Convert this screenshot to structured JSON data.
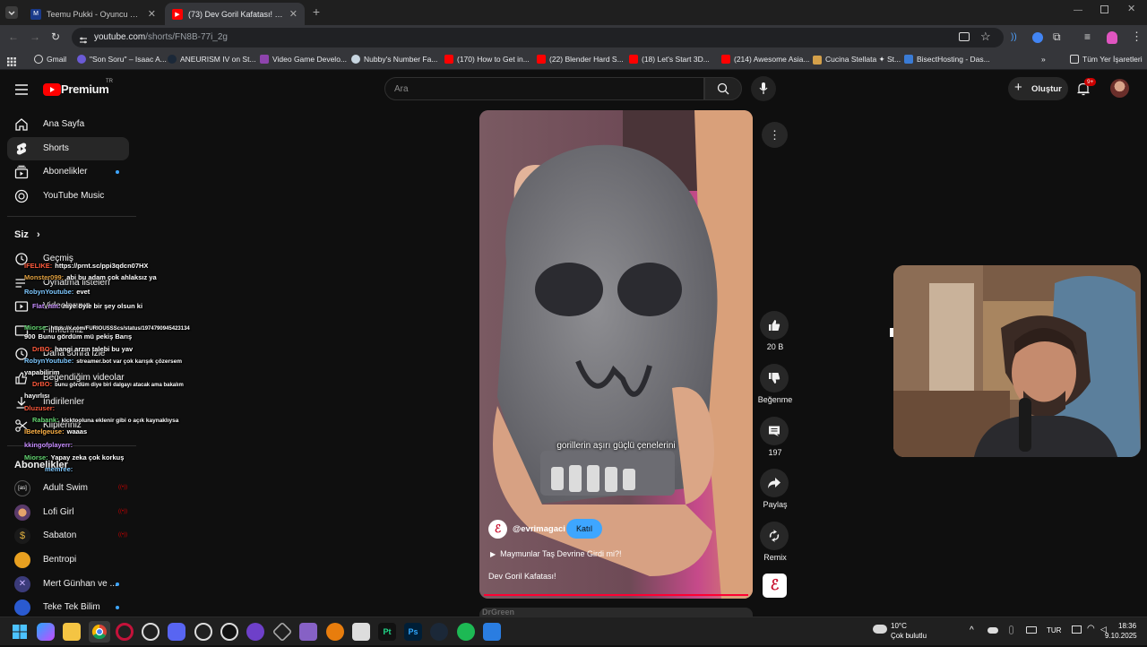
{
  "browser": {
    "tabs": [
      {
        "title": "Teemu Pukki - Oyuncu profili 2",
        "active": false
      },
      {
        "title": "(73) Dev Goril Kafatası! - YouTu",
        "active": true
      }
    ],
    "url_main": "youtube.com",
    "url_path": "/shorts/FN8B-77i_2g",
    "bookmarks": [
      "Gmail",
      "\"Son Soru\" – Isaac A...",
      "ANEURISM IV on St...",
      "Video Game Develo...",
      "Nubby's Number Fa...",
      "(170) How to Get in...",
      "(22) Blender Hard S...",
      "(18) Let's Start 3D...",
      "(214) Awesome Asia...",
      "Cucina Stellata ✦ St...",
      "BisectHosting - Das..."
    ],
    "all_bookmarks": "Tüm Yer İşaretleri"
  },
  "yt": {
    "logo_text": "Premium",
    "logo_sup": "TR",
    "search_placeholder": "Ara",
    "create_label": "Oluştur",
    "notif_badge": "9+"
  },
  "sidebar": {
    "main": [
      "Ana Sayfa",
      "Shorts",
      "Abonelikler",
      "YouTube Music"
    ],
    "siz_title": "Siz",
    "siz_items": [
      "Geçmiş",
      "Oynatma listeleri",
      "Videolarınız",
      "Filmleriniz",
      "Daha sonra izle",
      "Beğendiğim videolar",
      "İndirilenler",
      "Klipleriniz"
    ],
    "subs_title": "Abonelikler",
    "channels": [
      "Adult Swim",
      "Lofi Girl",
      "Sabaton",
      "Bentropi",
      "Mert Günhan ve ...",
      "Teke Tek Bilim"
    ]
  },
  "chat": [
    {
      "user": "IFELIKE:",
      "msg": "https://prnt.sc/ppi3qdcn07HX",
      "color": "#ff5a3c"
    },
    {
      "user": "Monster099:",
      "msg": "abi bu adam çok ahlaksız ya",
      "color": "#e0a040"
    },
    {
      "user": "RobynYoutube:",
      "msg": "evet",
      "color": "#7ec8ff"
    },
    {
      "user": "Flat_nm:",
      "msg": "niye öyle bir şey olsun ki",
      "color": "#c78dff"
    },
    {
      "user": "Miorse:",
      "msg": "https://x.com/FURIOUSSScs/status/1974790945423134",
      "color": "#63d471"
    },
    {
      "user": "900",
      "msg": "Bunu gördüm mü pekiş Barış",
      "color": "#ffffff"
    },
    {
      "user": "DrBO:",
      "msg": "hangi arzın talebi bu yav",
      "color": "#ff5a3c"
    },
    {
      "user": "RobynYoutube:",
      "msg": "streamer.bot var çok karışık çözersem",
      "color": "#7ec8ff"
    },
    {
      "user": "yapabilirim",
      "msg": "",
      "color": "#ffffff"
    },
    {
      "user": "DrBO:",
      "msg": "bunu gördüm diye biri dalgayı atacak ama bakalım",
      "color": "#ff5a3c"
    },
    {
      "user": "hayırlısı",
      "msg": "",
      "color": "#ffffff"
    },
    {
      "user": "Dluzuser:",
      "msg": "",
      "color": "#ff5a3c"
    },
    {
      "user": "Rabank:",
      "msg": "kicktooluna eklenir gibi o açık kaynaklıysa",
      "color": "#63d471"
    },
    {
      "user": "IBetelgeuse:",
      "msg": "waaas",
      "color": "#ffb347"
    },
    {
      "user": "kkingofplayerr:",
      "msg": "",
      "color": "#c78dff"
    },
    {
      "user": "Miorse:",
      "msg": "Yapay zeka çok korkuş",
      "color": "#63d471"
    },
    {
      "user": "memree:",
      "msg": "",
      "color": "#7ec8ff"
    }
  ],
  "short": {
    "subtitle": "gorillerin aşırı güçlü çenelerini",
    "channel": "@evrimagaci",
    "join_label": "Katıl",
    "playlist": "Maymunlar Taş Devrine Girdi mi?!",
    "title": "Dev Goril Kafatası!",
    "next_watermark": "DrGreen",
    "progress_percent": 100
  },
  "actions": {
    "like_count": "20 B",
    "dislike_label": "Beğenme",
    "comment_count": "197",
    "share_label": "Paylaş",
    "remix_label": "Remix"
  },
  "taskbar": {
    "weather_temp": "10°C",
    "weather_desc": "Çok bulutlu",
    "lang": "TUR",
    "time": "18:36",
    "date": "9.10.2025"
  }
}
